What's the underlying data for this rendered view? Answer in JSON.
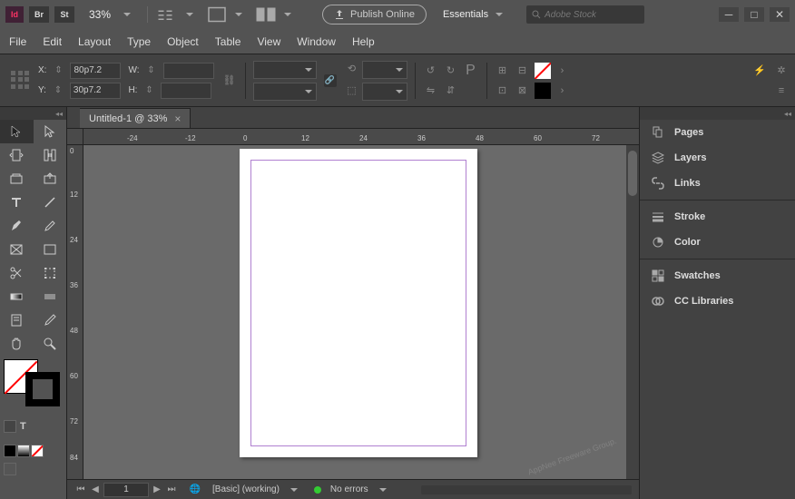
{
  "app": {
    "logo": "Id",
    "bridge": "Br",
    "stock_btn": "St",
    "zoom": "33%",
    "publish": "Publish Online",
    "workspace": "Essentials",
    "stock_placeholder": "Adobe Stock"
  },
  "menu": [
    "File",
    "Edit",
    "Layout",
    "Type",
    "Object",
    "Table",
    "View",
    "Window",
    "Help"
  ],
  "ctrl": {
    "x_label": "X:",
    "y_label": "Y:",
    "x_val": "80p7.2",
    "y_val": "30p7.2",
    "w_label": "W:",
    "h_label": "H:"
  },
  "doc": {
    "tab": "Untitled-1 @ 33%"
  },
  "ruler_h": [
    -24,
    -12,
    0,
    12,
    24,
    36,
    48,
    60,
    72
  ],
  "ruler_v": [
    0,
    12,
    24,
    36,
    48,
    60,
    72,
    84
  ],
  "status": {
    "page": "1",
    "style": "[Basic] (working)",
    "errors": "No errors"
  },
  "panels": {
    "pages": "Pages",
    "layers": "Layers",
    "links": "Links",
    "stroke": "Stroke",
    "color": "Color",
    "swatches": "Swatches",
    "cc": "CC Libraries"
  }
}
